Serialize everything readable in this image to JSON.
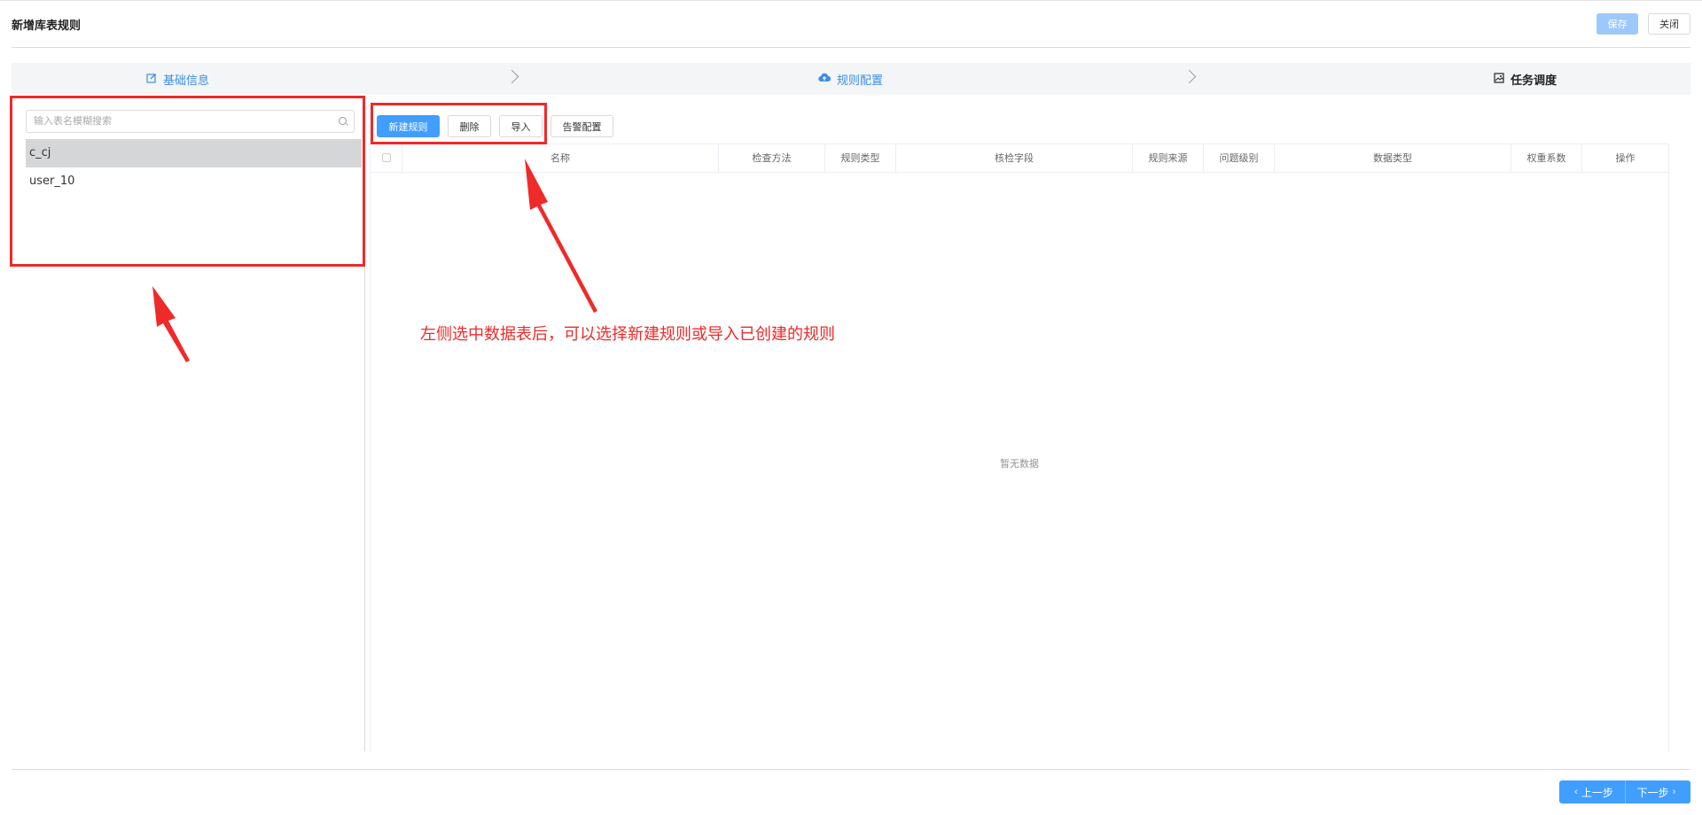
{
  "header": {
    "title": "新增库表规则",
    "save_label": "保存",
    "close_label": "关闭"
  },
  "steps": [
    {
      "label": "基础信息",
      "icon": "edit-icon"
    },
    {
      "label": "规则配置",
      "icon": "cloud-upload-icon"
    },
    {
      "label": "任务调度",
      "icon": "picture-icon"
    }
  ],
  "sidebar": {
    "search_placeholder": "输入表名模糊搜索",
    "tables": [
      {
        "name": "c_cj",
        "selected": true
      },
      {
        "name": "user_10",
        "selected": false
      }
    ]
  },
  "toolbar": {
    "new_rule": "新建规则",
    "delete": "删除",
    "import": "导入",
    "alert_config": "告警配置"
  },
  "table": {
    "columns": [
      "名称",
      "检查方法",
      "规则类型",
      "核检字段",
      "规则来源",
      "问题级别",
      "数据类型",
      "权重系数",
      "操作"
    ],
    "empty_text": "暂无数据"
  },
  "annotation": {
    "text": "左侧选中数据表后，可以选择新建规则或导入已创建的规则",
    "color": "#ee2a2a"
  },
  "footer": {
    "prev_label": "上一步",
    "next_label": "下一步"
  },
  "colors": {
    "primary": "#409eff",
    "active_step": "#3a8ee6",
    "save_disabled": "#9cc9fb"
  }
}
